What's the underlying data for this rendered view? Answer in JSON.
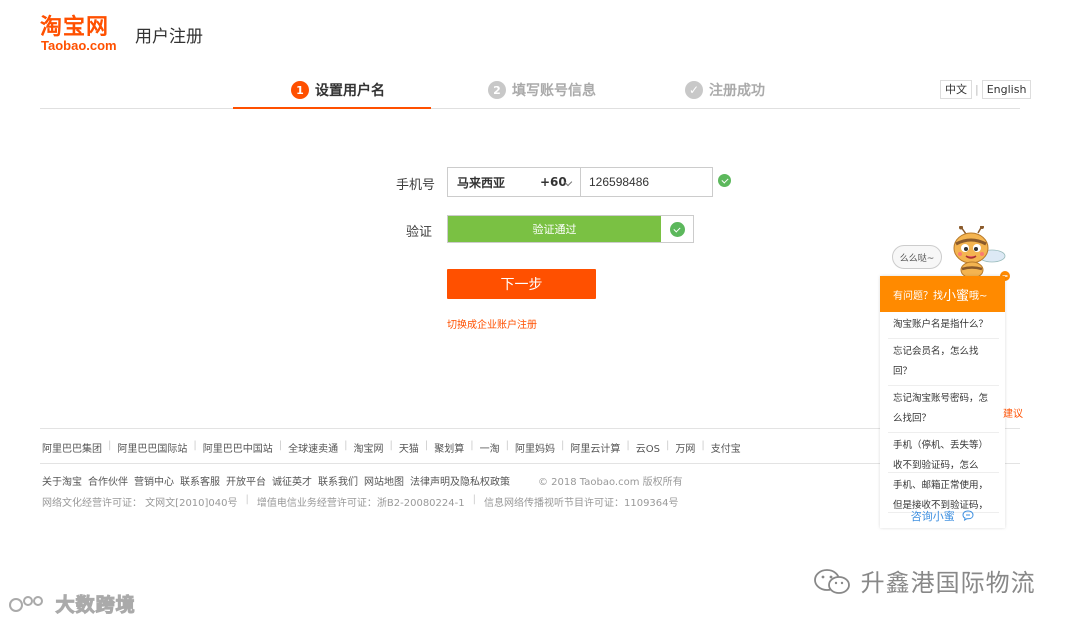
{
  "header": {
    "logo_cn": "淘宝网",
    "logo_en": "Taobao.com",
    "page_title": "用户注册"
  },
  "steps": [
    {
      "num": "1",
      "label": "设置用户名",
      "active": true
    },
    {
      "num": "2",
      "label": "填写账号信息",
      "active": false
    },
    {
      "num": "✓",
      "label": "注册成功",
      "active": false
    }
  ],
  "lang": {
    "zh": "中文",
    "sep": "|",
    "en": "English"
  },
  "form": {
    "phone_label": "手机号",
    "country": "马来西亚",
    "country_code": "+60",
    "phone_value": "126598486",
    "verify_label": "验证",
    "verify_text": "验证通过",
    "next_button": "下一步",
    "business_link": "切换成企业账户注册"
  },
  "footer": {
    "links_row1": [
      "阿里巴巴集团",
      "阿里巴巴国际站",
      "阿里巴巴中国站",
      "全球速卖通",
      "淘宝网",
      "天猫",
      "聚划算",
      "一淘",
      "阿里妈妈",
      "阿里云计算",
      "云OS",
      "万网",
      "支付宝"
    ],
    "links_row2": [
      "关于淘宝",
      "合作伙伴",
      "营销中心",
      "联系客服",
      "开放平台",
      "诚征英才",
      "联系我们",
      "网站地图",
      "法律声明及隐私权政策"
    ],
    "copyright": "© 2018 Taobao.com 版权所有",
    "licenses": [
      "网络文化经营许可证： 文网文[2010]040号",
      "增值电信业务经营许可证：浙B2-20080224-1",
      "信息网络传播视听节目许可证：1109364号"
    ]
  },
  "help": {
    "bubble": "么么哒~",
    "head_prefix": "有问题？找",
    "head_name": "小蜜",
    "head_suffix": "哦~",
    "items": [
      "淘宝账户名是指什么？",
      "忘记会员名，怎么找回？",
      "忘记淘宝账号密码，怎么找回？",
      "手机（停机、丢失等）收不到验证码，怎么",
      "手机、邮箱正常使用，但是接收不到验证码，"
    ],
    "consult": "咨询小蜜",
    "suggest": "建议"
  },
  "watermarks": {
    "left": "大数跨境",
    "right": "升鑫港国际物流"
  },
  "colors": {
    "brand": "#ff5000",
    "success": "#7ac143",
    "help_orange": "#ff8a00"
  }
}
